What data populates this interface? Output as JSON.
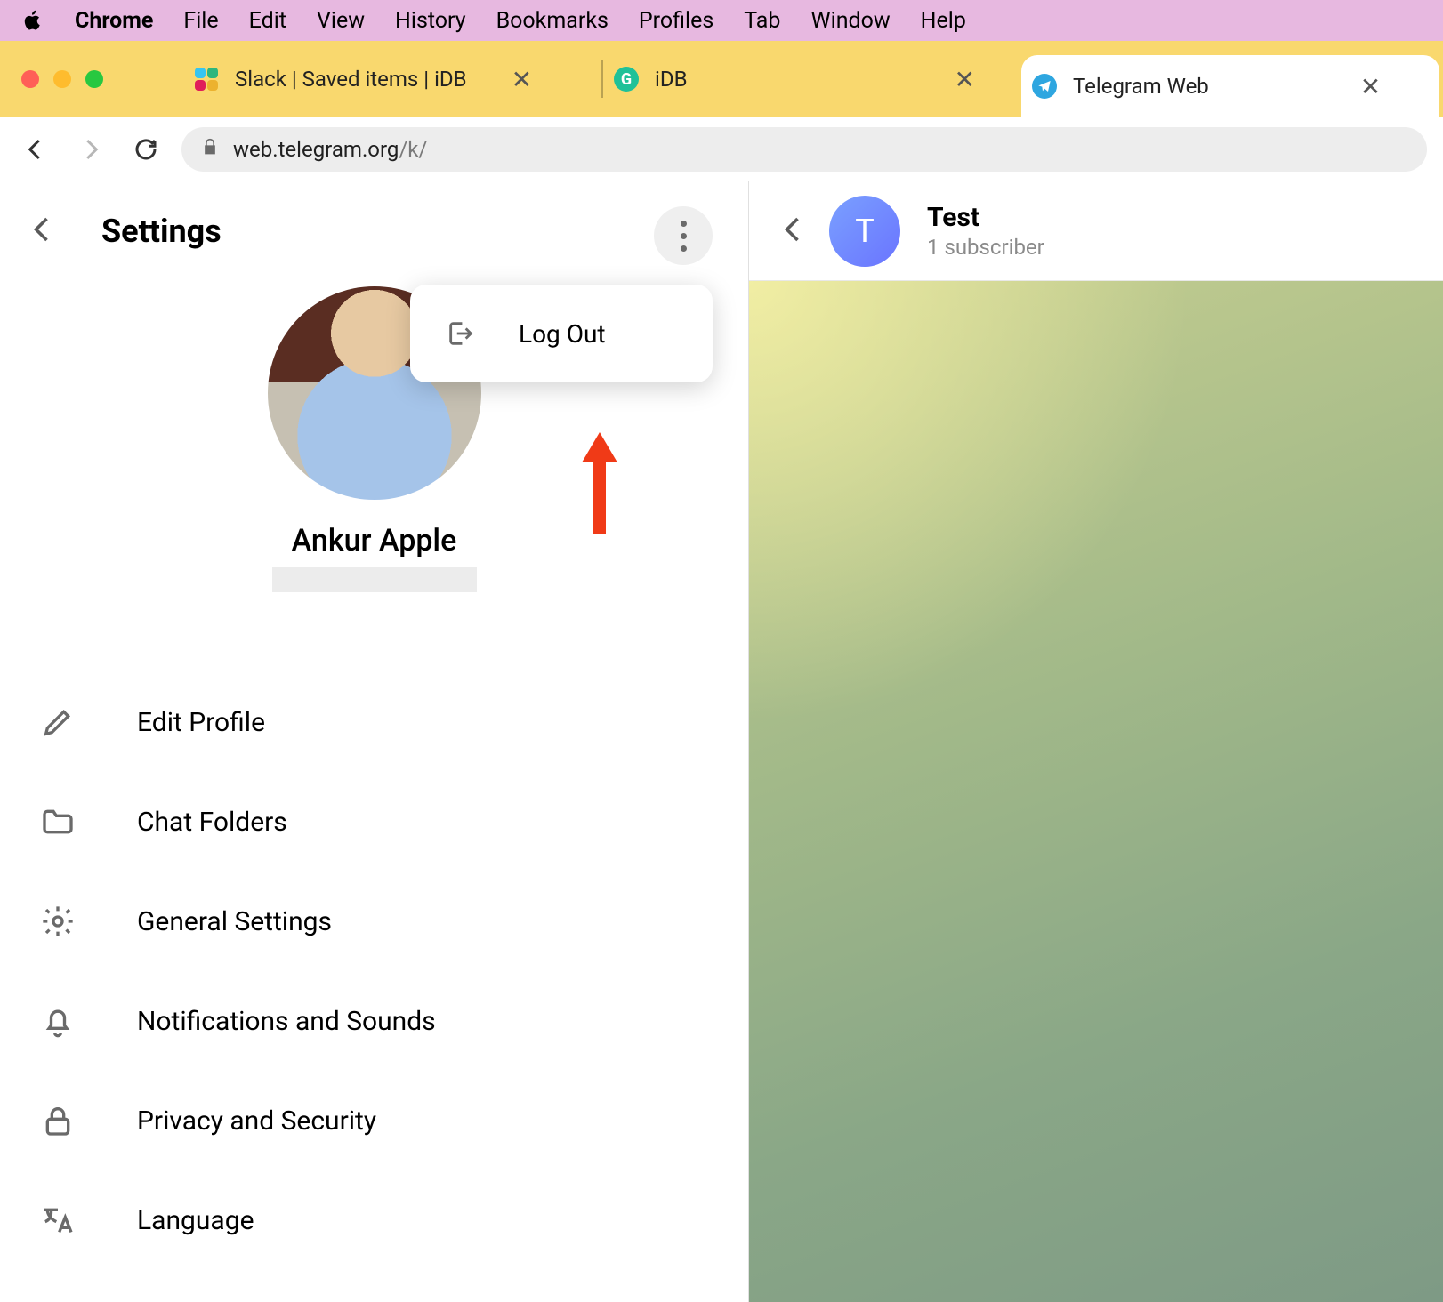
{
  "mac_menubar": {
    "app_name": "Chrome",
    "items": [
      "File",
      "Edit",
      "View",
      "History",
      "Bookmarks",
      "Profiles",
      "Tab",
      "Window",
      "Help"
    ]
  },
  "browser": {
    "tabs": [
      {
        "label": "Slack | Saved items | iDB",
        "active": false
      },
      {
        "label": "iDB",
        "active": false
      },
      {
        "label": "Telegram Web",
        "active": true
      }
    ],
    "url_host": "web.telegram.org",
    "url_path": "/k/"
  },
  "settings": {
    "title": "Settings",
    "profile_name": "Ankur Apple",
    "menu_logout": "Log Out",
    "items": [
      "Edit Profile",
      "Chat Folders",
      "General Settings",
      "Notifications and Sounds",
      "Privacy and Security",
      "Language"
    ]
  },
  "chat": {
    "avatar_letter": "T",
    "title": "Test",
    "subtitle": "1 subscriber"
  },
  "favicons": {
    "idb_letter": "G"
  },
  "colors": {
    "annotation": "#f03a17",
    "telegram_blue": "#2ea6e0"
  }
}
